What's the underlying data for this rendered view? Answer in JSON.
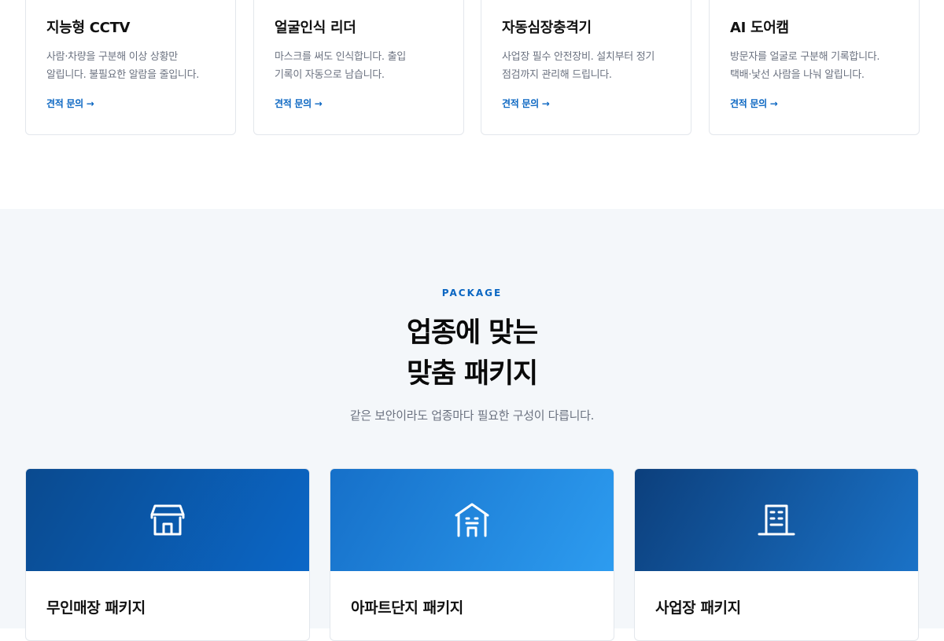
{
  "products": [
    {
      "title": "지능형 CCTV",
      "desc": "사람·차량을 구분해 이상 상황만\n알립니다. 불필요한 알람을 줄입니다.",
      "link": "견적 문의 →"
    },
    {
      "title": "얼굴인식 리더",
      "desc": "마스크를 써도 인식합니다. 출입\n기록이 자동으로 남습니다.",
      "link": "견적 문의 →"
    },
    {
      "title": "자동심장충격기",
      "desc": "사업장 필수 안전장비. 설치부터 정기\n점검까지 관리해 드립니다.",
      "link": "견적 문의 →"
    },
    {
      "title": "AI 도어캠",
      "desc": "방문자를 얼굴로 구분해 기록합니다.\n택배·낯선 사람을 나눠 알립니다.",
      "link": "견적 문의 →"
    }
  ],
  "package": {
    "eyebrow": "PACKAGE",
    "headline_line1": "업종에 맞는",
    "headline_line2": "맞춤 패키지",
    "subtext": "같은 보안이라도 업종마다 필요한 구성이 다릅니다.",
    "cards": [
      {
        "title": "무인매장 패키지",
        "icon": "store-icon"
      },
      {
        "title": "아파트단지 패키지",
        "icon": "apartment-icon"
      },
      {
        "title": "사업장 패키지",
        "icon": "office-building-icon"
      }
    ]
  },
  "colors": {
    "accent": "#0a66c2",
    "section_bg": "#f4f7fa"
  }
}
